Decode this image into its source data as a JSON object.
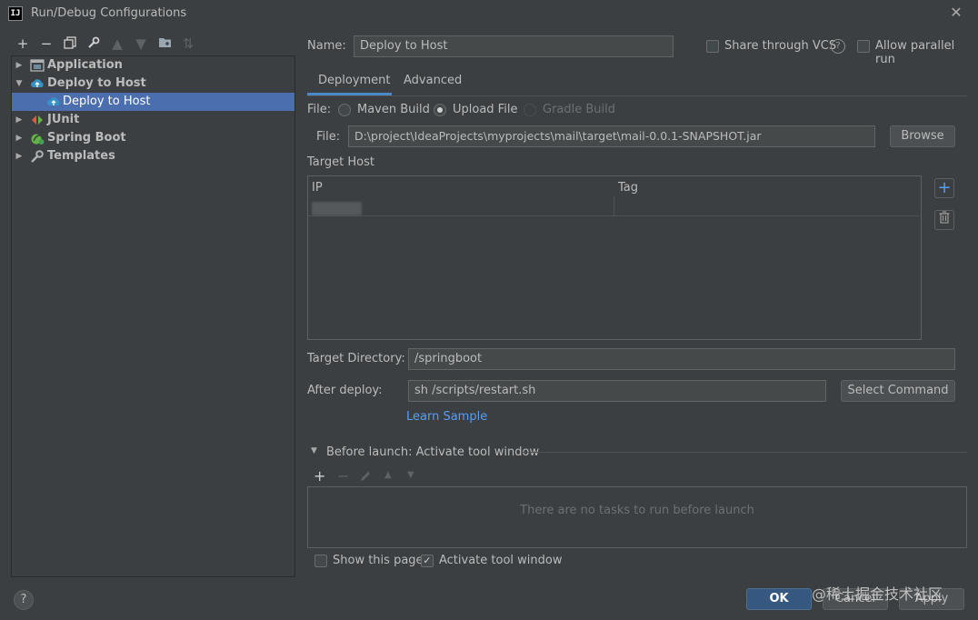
{
  "window": {
    "title": "Run/Debug Configurations",
    "app_icon": "IJ"
  },
  "toolbar": {
    "icons": [
      "plus-icon",
      "minus-icon",
      "copy-icon",
      "wrench-icon",
      "arrow-up-icon",
      "arrow-down-icon",
      "folder-icon",
      "sort-icon"
    ]
  },
  "tree": {
    "items": [
      {
        "label": "Application",
        "expanded": false
      },
      {
        "label": "Deploy to Host",
        "expanded": true
      },
      {
        "label": "Deploy to Host",
        "child": true,
        "selected": true
      },
      {
        "label": "JUnit",
        "expanded": false
      },
      {
        "label": "Spring Boot",
        "expanded": false
      },
      {
        "label": "Templates",
        "expanded": false
      }
    ]
  },
  "form": {
    "name_label": "Name:",
    "name_value": "Deploy to Host",
    "share_vcs_label": "Share through VCS",
    "allow_parallel_label": "Allow parallel run",
    "tabs": [
      {
        "label": "Deployment",
        "selected": true
      },
      {
        "label": "Advanced"
      }
    ],
    "file_type_label": "File:",
    "file_options": [
      "Maven Build",
      "Upload File",
      "Gradle Build"
    ],
    "file_selected": "Upload File",
    "file_path_label": "File:",
    "file_path_value": "D:\\project\\IdeaProjects\\myprojects\\mail\\target\\mail-0.0.1-SNAPSHOT.jar",
    "browse_label": "Browse",
    "target_host_label": "Target Host",
    "table_columns": [
      "IP",
      "Tag"
    ],
    "target_dir_label": "Target Directory:",
    "target_dir_value": "/springboot",
    "after_deploy_label": "After deploy:",
    "after_deploy_value": "sh /scripts/restart.sh",
    "select_command_label": "Select Command",
    "learn_sample_label": "Learn Sample",
    "before_launch_label": "Before launch: Activate tool window",
    "before_launch_empty": "There are no tasks to run before launch",
    "show_page_label": "Show this page",
    "activate_tool_label": "Activate tool window"
  },
  "footer": {
    "ok_label": "OK",
    "cancel_label": "Cancel",
    "apply_label": "Apply",
    "watermark": "@稀土掘金技术社区"
  },
  "colors": {
    "accent": "#4b6eaf",
    "primary_button": "#365880",
    "link": "#589df6",
    "background": "#3c3f41"
  }
}
